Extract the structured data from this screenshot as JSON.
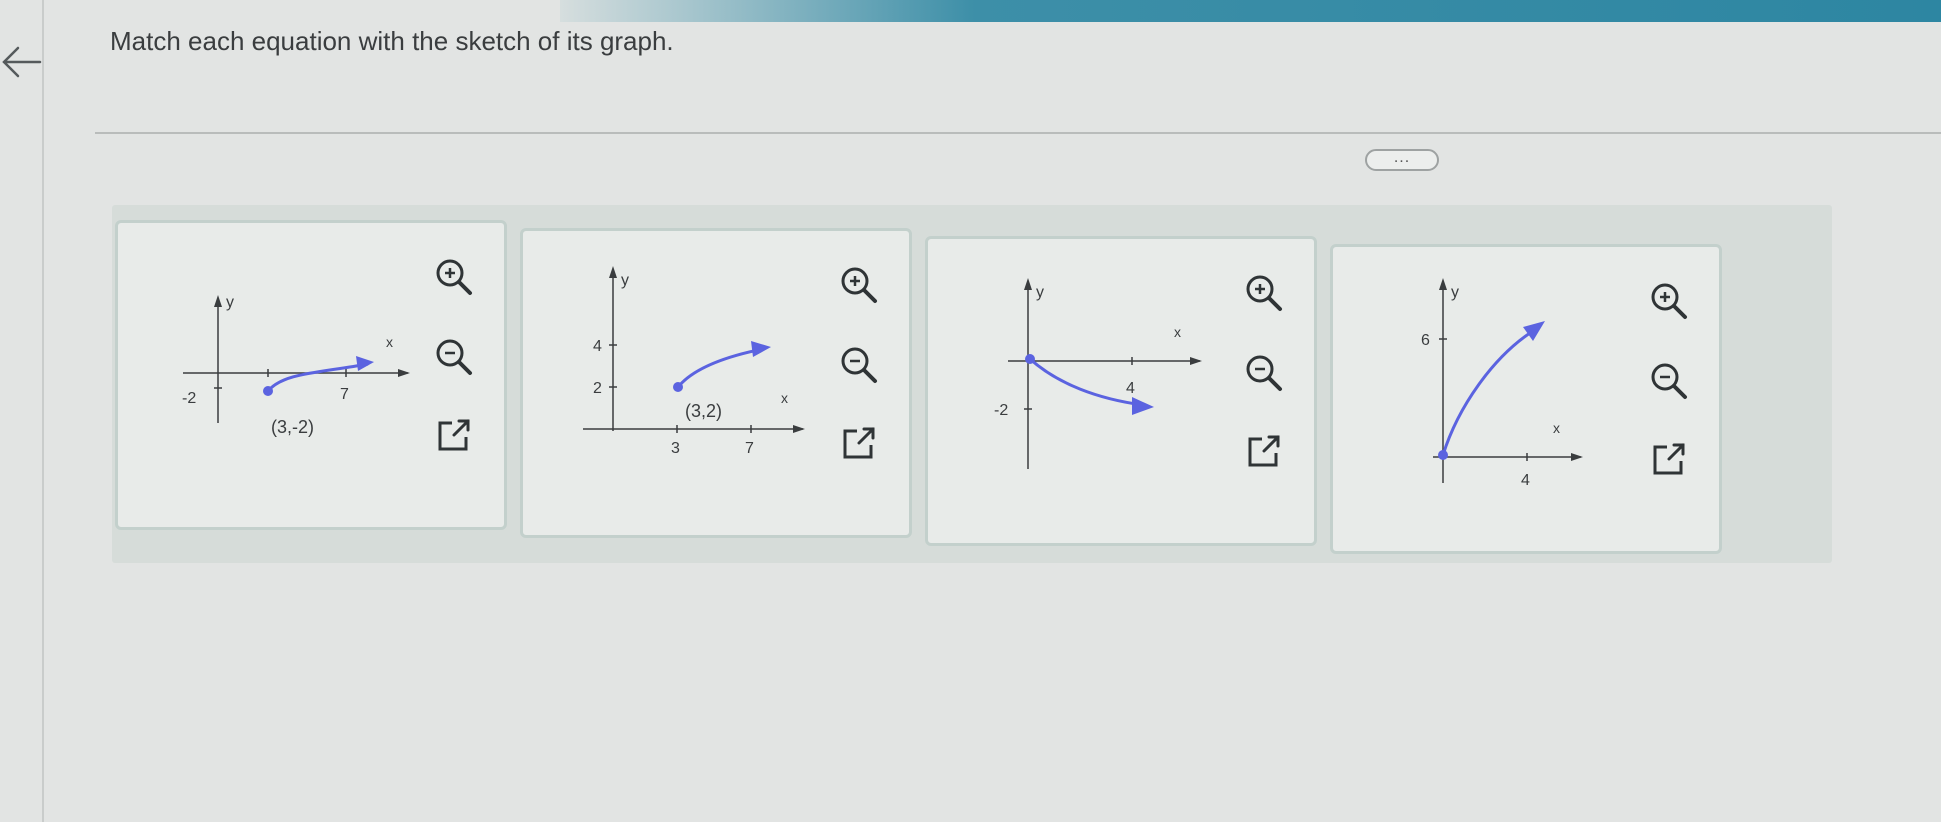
{
  "prompt": "Match each equation with the sketch of its graph.",
  "more_label": "...",
  "graphs": [
    {
      "y_label": "y",
      "x_label": "x",
      "ticks": [
        "-2",
        "7"
      ],
      "point_label": "(3,-2)"
    },
    {
      "y_label": "y",
      "x_label": "x",
      "ticks": [
        "4",
        "2",
        "3",
        "7"
      ],
      "point_label": "(3,2)"
    },
    {
      "y_label": "y",
      "x_label": "x",
      "ticks": [
        "-2",
        "4"
      ]
    },
    {
      "y_label": "y",
      "x_label": "x",
      "ticks": [
        "6",
        "4"
      ]
    }
  ],
  "icons": {
    "back": "arrow-left-icon",
    "zoom_in": "zoom-in-icon",
    "zoom_out": "zoom-out-icon",
    "open": "open-external-icon"
  },
  "colors": {
    "curve": "#5b63e0",
    "accent": "#3f8fb0"
  }
}
